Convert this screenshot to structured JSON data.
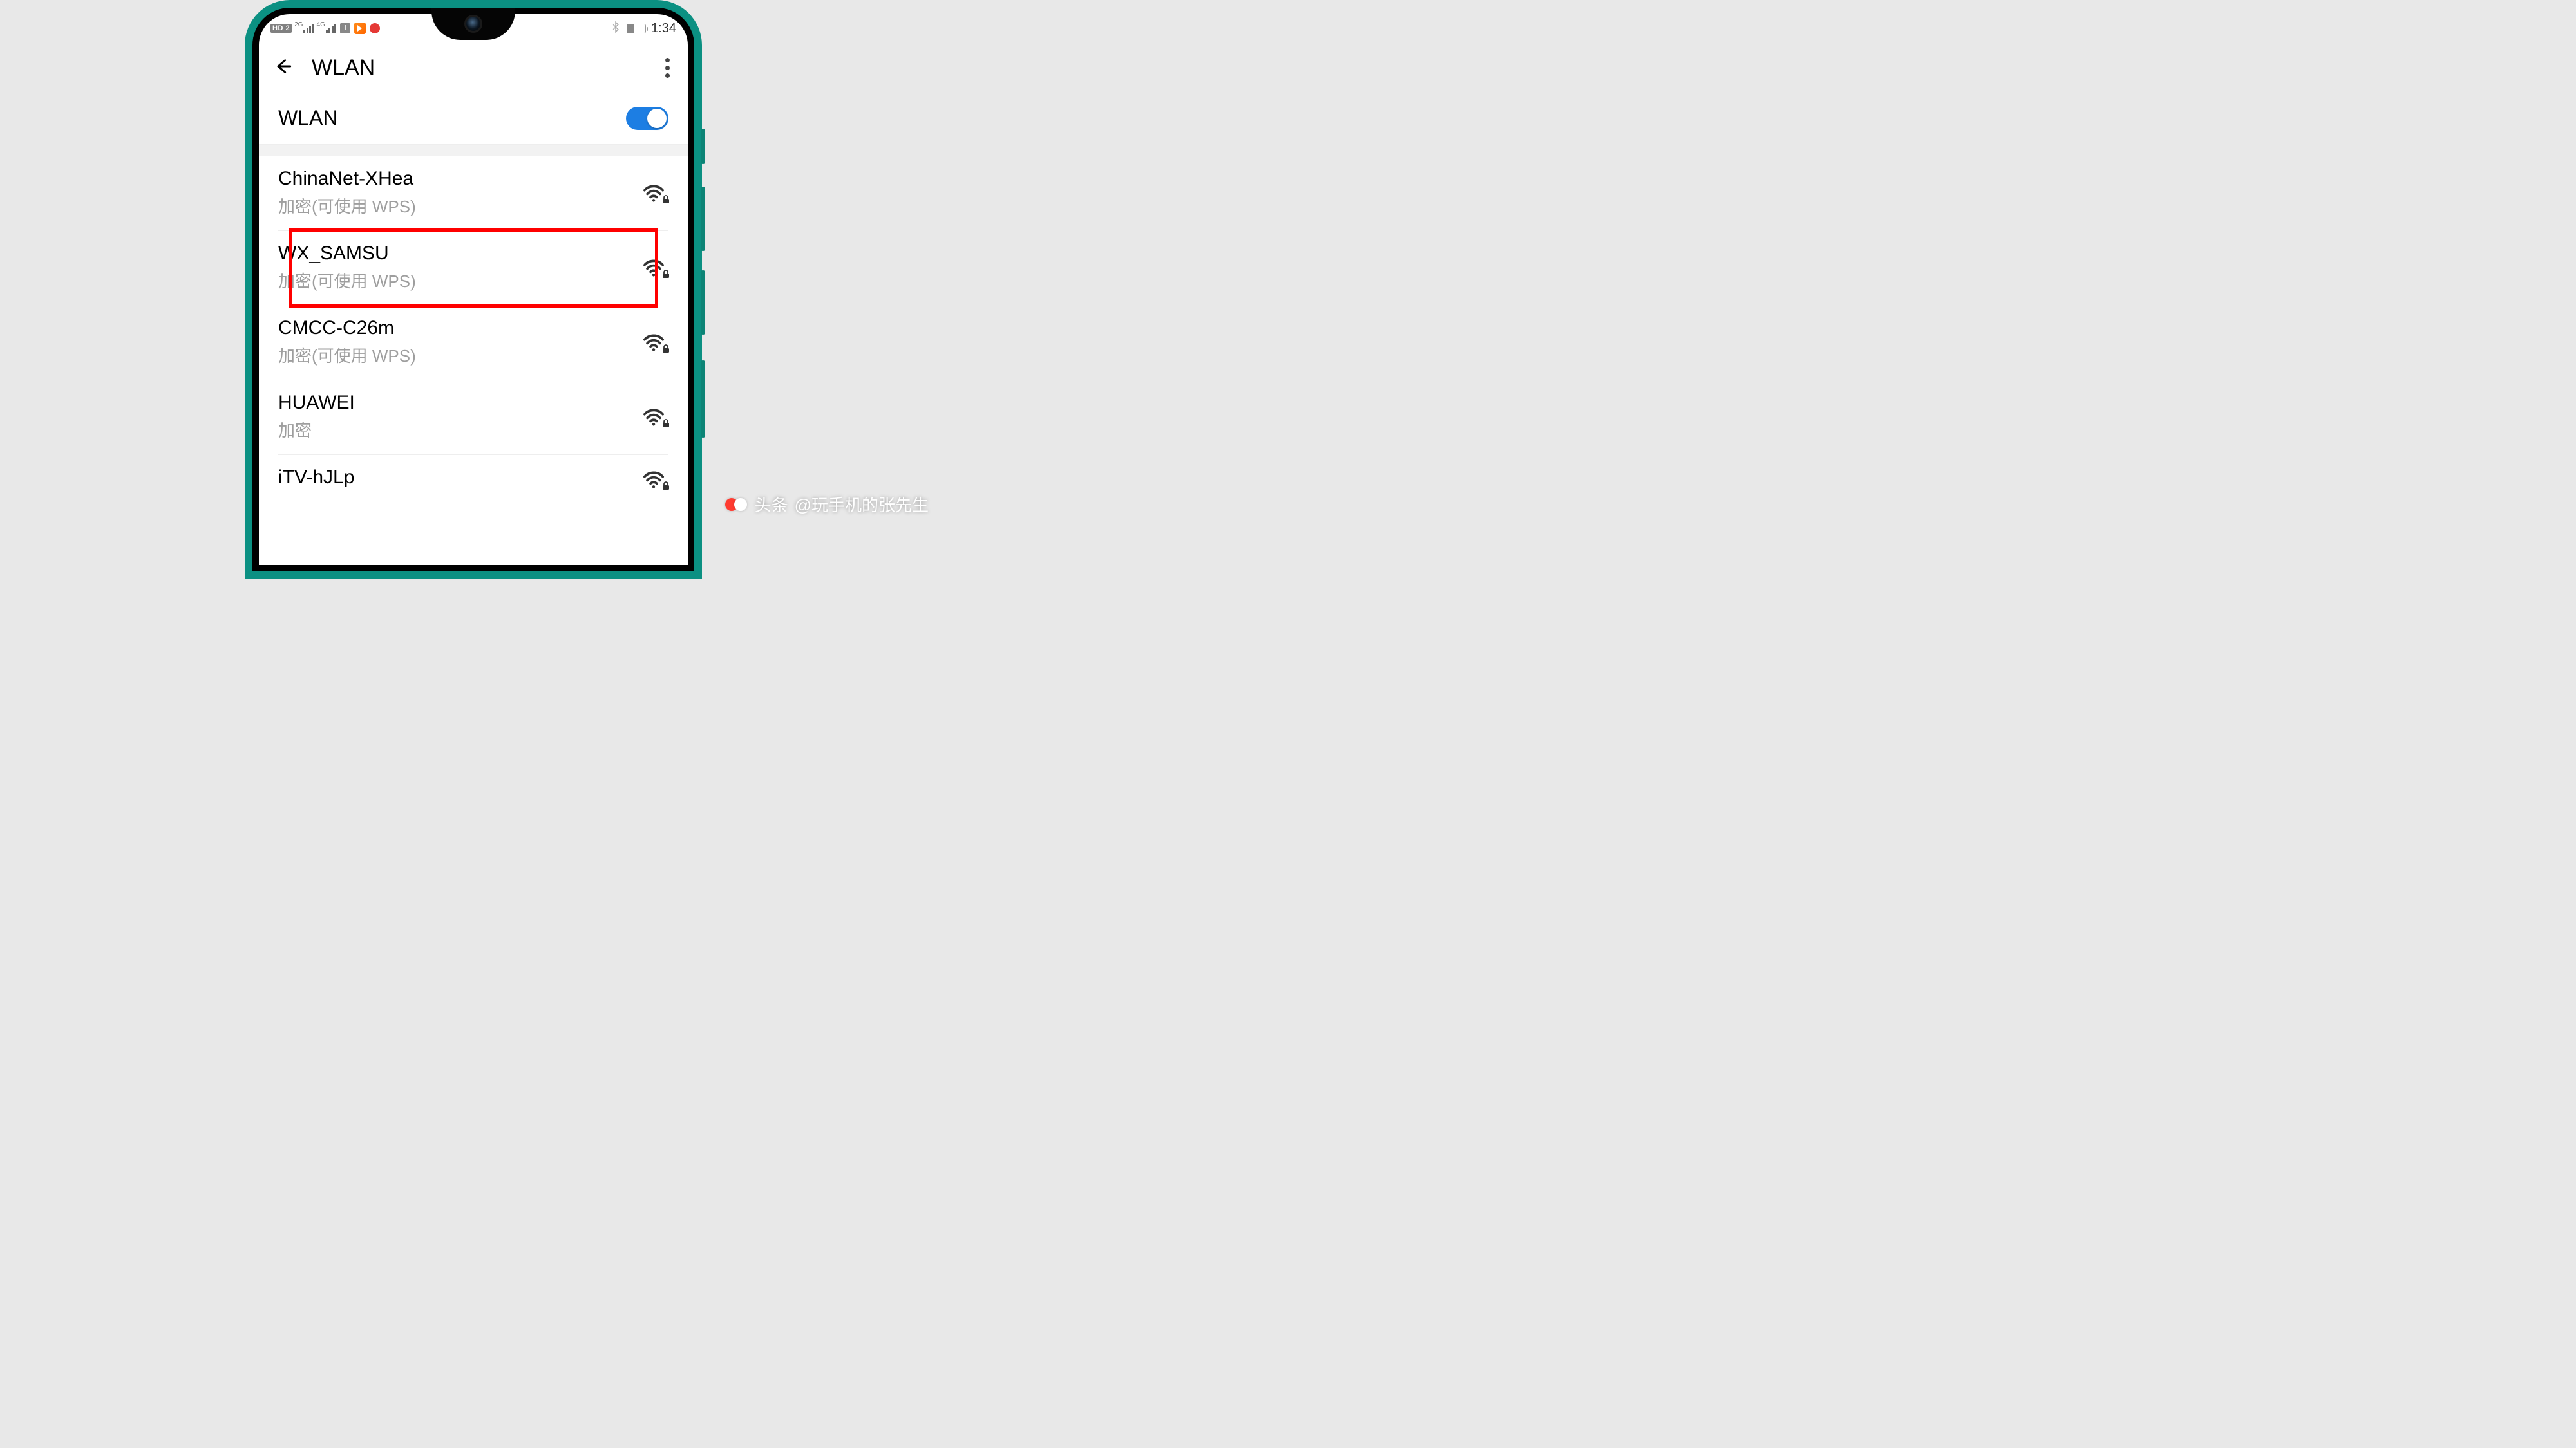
{
  "statusbar": {
    "hd_label": "HD 2",
    "signal1_label": "2G",
    "signal2_label": "4G",
    "time": "1:34"
  },
  "header": {
    "title": "WLAN"
  },
  "toggle": {
    "label": "WLAN",
    "on": true
  },
  "networks": [
    {
      "name": "ChinaNet-XHea",
      "subtitle": "加密(可使用 WPS)",
      "locked": true,
      "highlighted": false
    },
    {
      "name": "WX_SAMSU",
      "subtitle": "加密(可使用 WPS)",
      "locked": true,
      "highlighted": true
    },
    {
      "name": "CMCC-C26m",
      "subtitle": "加密(可使用 WPS)",
      "locked": true,
      "highlighted": false
    },
    {
      "name": "HUAWEI",
      "subtitle": "加密",
      "locked": true,
      "highlighted": false
    },
    {
      "name": "iTV-hJLp",
      "subtitle": "",
      "locked": true,
      "highlighted": false
    }
  ],
  "watermark": {
    "prefix": "头条",
    "handle": "@玩手机的张先生"
  }
}
